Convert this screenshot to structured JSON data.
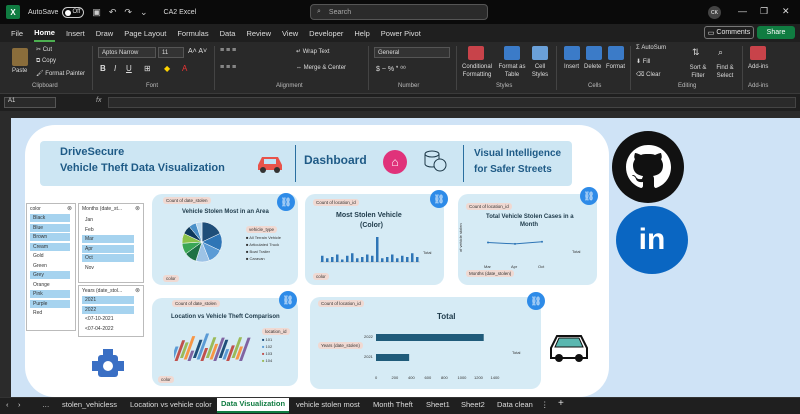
{
  "titlebar": {
    "autosave": "AutoSave",
    "toggle": "Off",
    "filename": "CA2 Excel",
    "search_placeholder": "Search",
    "avatar": "CK"
  },
  "menu": [
    "File",
    "Home",
    "Insert",
    "Draw",
    "Page Layout",
    "Formulas",
    "Data",
    "Review",
    "View",
    "Developer",
    "Help",
    "Power Pivot"
  ],
  "menu_buttons": {
    "comments": "Comments",
    "share": "Share"
  },
  "ribbon": {
    "clipboard": {
      "paste": "Paste",
      "cut": "Cut",
      "copy": "Copy",
      "format_painter": "Format Painter",
      "label": "Clipboard"
    },
    "font": {
      "name": "Aptos Narrow",
      "size": "11",
      "label": "Font"
    },
    "alignment": {
      "wrap": "Wrap Text",
      "merge": "Merge & Center",
      "label": "Alignment"
    },
    "number": {
      "format": "General",
      "label": "Number"
    },
    "styles": {
      "cond": "Conditional Formatting",
      "table": "Format as Table",
      "cell": "Cell Styles",
      "label": "Styles"
    },
    "cells": {
      "insert": "Insert",
      "delete": "Delete",
      "format": "Format",
      "label": "Cells"
    },
    "editing": {
      "autosum": "AutoSum",
      "fill": "Fill",
      "clear": "Clear",
      "sort": "Sort & Filter",
      "find": "Find & Select",
      "label": "Editing"
    },
    "addins": {
      "addins": "Add-ins",
      "label": "Add-ins"
    }
  },
  "formula": {
    "cell": "A1",
    "fx": "fx"
  },
  "header": {
    "title1": "DriveSecure",
    "title2": "Vehicle Theft Data Visualization",
    "dashboard": "Dashboard",
    "tag1": "Visual Intelligence",
    "tag2": "for Safer Streets"
  },
  "slicers": {
    "color": {
      "title": "color",
      "items": [
        "Black",
        "Blue",
        "Brown",
        "Cream",
        "Gold",
        "Green",
        "Grey",
        "Orange",
        "Pink",
        "Purple",
        "Red"
      ],
      "selected": [
        true,
        true,
        true,
        true,
        false,
        false,
        true,
        false,
        true,
        true,
        false
      ]
    },
    "months": {
      "title": "Months (date_st...",
      "items": [
        "Jan",
        "Feb",
        "Mar",
        "Apr",
        "Oct",
        "Nov"
      ],
      "selected": [
        false,
        false,
        true,
        true,
        true,
        false
      ]
    },
    "years": {
      "title": "Years (date_stol...",
      "items": [
        "2021",
        "2022",
        "<07-10-2021",
        "<07-04-2022"
      ],
      "selected": [
        true,
        true,
        false,
        false
      ]
    }
  },
  "panels": {
    "p1": {
      "chip": "Count of date_stolen",
      "title": "Vehicle Stolen Most in an Area",
      "filter_chip": "color",
      "legend_title": "vehicle_type",
      "legend": [
        "All Terrain Vehicle",
        "Articulated Truck",
        "Boat Trailer",
        "Caravan"
      ]
    },
    "p2": {
      "chip": "Count of location_id",
      "title1": "Most Stolen Vehicle",
      "title2": "(Color)",
      "filter_chip": "color",
      "legend": "Total"
    },
    "p3": {
      "chip": "Count of location_id",
      "title1": "Total Vehicle Stolen Cases in a",
      "title2": "Month",
      "ylabel": "of vehicle stolen",
      "legend": "Total",
      "xticks": [
        "Mar",
        "Apr",
        "Oct"
      ],
      "filter_chip": "Months (date_stolen)"
    },
    "p4": {
      "chip": "Count of date_stolen",
      "title": "Location vs Vehicle Theft Comparison",
      "legend_title": "location_id",
      "legend": [
        "101",
        "102",
        "103",
        "104"
      ],
      "filter_chip": "color"
    },
    "p5": {
      "chip": "Count of location_id",
      "title": "Total",
      "filter_chip": "Years (date_stolen)",
      "categories": [
        "2022",
        "2021"
      ],
      "xticks": [
        "0",
        "200",
        "400",
        "600",
        "800",
        "1000",
        "1200",
        "1400"
      ],
      "legend": "Total"
    }
  },
  "chart_data": [
    {
      "type": "pie",
      "title": "Vehicle Stolen Most in an Area",
      "values": [
        18,
        14,
        12,
        11,
        10,
        9,
        8,
        7,
        6,
        5
      ],
      "colors": [
        "#1f4e79",
        "#2e75b6",
        "#5b9bd5",
        "#9dc3e6",
        "#1e7145",
        "#3aa655",
        "#8bc34a",
        "#0e3a5c",
        "#4a90c8",
        "#b7d7ee"
      ]
    },
    {
      "type": "bar",
      "title": "Most Stolen Vehicle (Color)",
      "values": [
        5,
        3,
        4,
        6,
        2,
        5,
        7,
        3,
        4,
        6,
        5,
        20,
        3,
        4,
        6,
        3,
        5,
        4,
        7,
        4
      ],
      "ylim": [
        0,
        60
      ]
    },
    {
      "type": "line",
      "title": "Total Vehicle Stolen Cases in a Month",
      "categories": [
        "Mar",
        "Apr",
        "Oct"
      ],
      "values": [
        1250,
        1150,
        1300
      ],
      "ylim": [
        0,
        2000
      ]
    },
    {
      "type": "bar",
      "title": "Location vs Vehicle Theft Comparison",
      "values": [
        3,
        5,
        8,
        6,
        9,
        4,
        7,
        10,
        5,
        8,
        6,
        9,
        7,
        4,
        6,
        8,
        5,
        9
      ],
      "ylim": [
        0,
        100
      ]
    },
    {
      "type": "bar",
      "title": "Total",
      "categories": [
        "2022",
        "2021"
      ],
      "values": [
        1300,
        400
      ],
      "xlim": [
        0,
        1400
      ]
    }
  ],
  "tabs": [
    "stolen_vehicless",
    "Location vs vehicle color",
    "Data Visualization",
    "vehicle stolen most",
    "Month Theft",
    "Sheet1",
    "Sheet2",
    "Data clean"
  ],
  "active_tab": "Data Visualization"
}
